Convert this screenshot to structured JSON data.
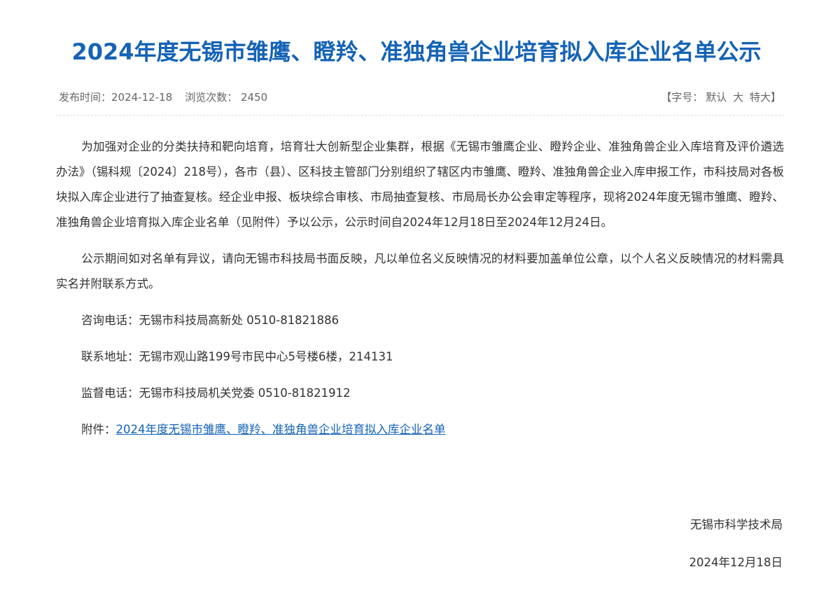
{
  "article": {
    "title": "2024年度无锡市雏鹰、瞪羚、准独角兽企业培育拟入库企业名单公示",
    "publish_label": "发布时间：",
    "publish_date": "2024-12-18",
    "views_label": "浏览次数：",
    "views_count": "2450",
    "font_size_open": "【字号：",
    "font_size_default": "默认",
    "font_size_large": "大",
    "font_size_xlarge": "特大",
    "font_size_close": "】"
  },
  "body": {
    "paragraph1": "为加强对企业的分类扶持和靶向培育，培育壮大创新型企业集群，根据《无锡市雏鹰企业、瞪羚企业、准独角兽企业入库培育及评价遴选办法》（锡科规〔2024〕218号），各市（县）、区科技主管部门分别组织了辖区内市雏鹰、瞪羚、准独角兽企业入库申报工作，市科技局对各板块拟入库企业进行了抽查复核。经企业申报、板块综合审核、市局抽查复核、市局局长办公会审定等程序，现将2024年度无锡市雏鹰、瞪羚、准独角兽企业培育拟入库企业名单（见附件）予以公示，公示时间自2024年12月18日至2024年12月24日。",
    "paragraph2": "公示期间如对名单有异议，请向无锡市科技局书面反映，凡以单位名义反映情况的材料要加盖单位公章，以个人名义反映情况的材料需具实名并附联系方式。",
    "consult_phone": "咨询电话：无锡市科技局高新处 0510-81821886",
    "address": "联系地址：无锡市观山路199号市民中心5号楼6楼，214131",
    "supervise_phone": "监督电话：无锡市科技局机关党委 0510-81821912",
    "attachment_label": "附件：",
    "attachment_link": "2024年度无锡市雏鹰、瞪羚、准独角兽企业培育拟入库企业名单"
  },
  "signature": {
    "org": "无锡市科学技术局",
    "date": "2024年12月18日"
  },
  "colors": {
    "title": "#1563b6",
    "link": "#1563b6",
    "body_text": "#333333",
    "meta_text": "#666666",
    "divider": "#d9d9d9"
  }
}
